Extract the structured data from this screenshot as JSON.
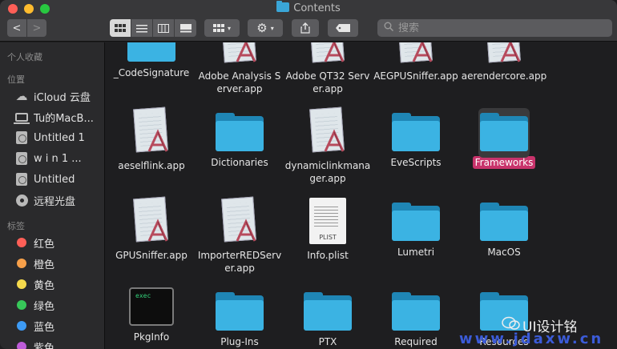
{
  "window": {
    "title": "Contents",
    "search_placeholder": "搜索"
  },
  "toolbar": {
    "back": "<",
    "forward": ">",
    "views": [
      "icon-view",
      "list-view",
      "column-view",
      "gallery-view"
    ],
    "group": "group-icon",
    "action": "gear-icon",
    "share": "share-icon",
    "tag": "tag-icon"
  },
  "sidebar": {
    "favorites_header": "个人收藏",
    "locations_header": "位置",
    "locations": [
      {
        "label": "iCloud 云盘",
        "icon": "cloud-icon"
      },
      {
        "label": "Tu的MacB...",
        "icon": "laptop-icon"
      },
      {
        "label": "Untitled 1",
        "icon": "disk-icon"
      },
      {
        "label": "w i n 1 ...",
        "icon": "disk-icon"
      },
      {
        "label": "Untitled",
        "icon": "disk-icon"
      },
      {
        "label": "远程光盘",
        "icon": "cd-icon"
      }
    ],
    "tags_header": "标签",
    "tags": [
      {
        "label": "红色",
        "color": "#fe5f57"
      },
      {
        "label": "橙色",
        "color": "#f7a04a"
      },
      {
        "label": "黄色",
        "color": "#f5d94c"
      },
      {
        "label": "绿色",
        "color": "#37c859"
      },
      {
        "label": "蓝色",
        "color": "#3d9bf5"
      },
      {
        "label": "紫色",
        "color": "#bf5cd9"
      }
    ]
  },
  "files": [
    {
      "name": "_CodeSignature",
      "kind": "folder"
    },
    {
      "name": "Adobe Analysis Server.app",
      "kind": "app"
    },
    {
      "name": "Adobe QT32 Server.app",
      "kind": "app"
    },
    {
      "name": "AEGPUSniffer.app",
      "kind": "app"
    },
    {
      "name": "aerendercore.app",
      "kind": "app"
    },
    {
      "name": "aeselflink.app",
      "kind": "app"
    },
    {
      "name": "Dictionaries",
      "kind": "folder"
    },
    {
      "name": "dynamiclinkmanager.app",
      "kind": "app"
    },
    {
      "name": "EveScripts",
      "kind": "folder"
    },
    {
      "name": "Frameworks",
      "kind": "folder",
      "selected": true
    },
    {
      "name": "GPUSniffer.app",
      "kind": "app"
    },
    {
      "name": "ImporterREDServer.app",
      "kind": "app"
    },
    {
      "name": "Info.plist",
      "kind": "plist",
      "badge": "PLIST"
    },
    {
      "name": "Lumetri",
      "kind": "folder"
    },
    {
      "name": "MacOS",
      "kind": "folder"
    },
    {
      "name": "PkgInfo",
      "kind": "exec",
      "badge": "exec"
    },
    {
      "name": "Plug-Ins",
      "kind": "folder"
    },
    {
      "name": "PTX",
      "kind": "folder"
    },
    {
      "name": "Required",
      "kind": "folder"
    },
    {
      "name": "Resources",
      "kind": "folder"
    }
  ],
  "watermark": {
    "title": "UI设计铭",
    "site": "www.jdaxw.cn"
  }
}
